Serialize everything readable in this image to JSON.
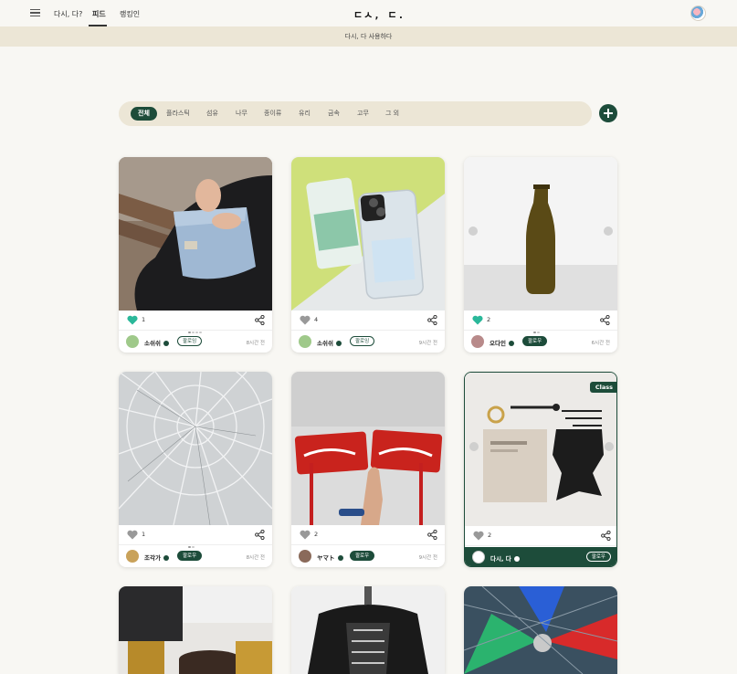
{
  "header": {
    "nav": [
      {
        "label": "다시, 다?"
      },
      {
        "label": "피드"
      },
      {
        "label": "랭킹인"
      }
    ],
    "logo": "ㄷㅅ, ㄷ."
  },
  "banner": {
    "text": "다시, 다 사용하다"
  },
  "filters": {
    "chips": [
      "전체",
      "플라스틱",
      "섬유",
      "나무",
      "종이류",
      "유리",
      "금속",
      "고무",
      "그 외"
    ]
  },
  "cards": [
    {
      "likes": "1",
      "author": "소쉬쉬",
      "follow": "팔로잉",
      "time": "8시간 전",
      "heart": "liked"
    },
    {
      "likes": "4",
      "author": "소쉬쉬",
      "follow": "팔로잉",
      "time": "9시간 전",
      "heart": "plain"
    },
    {
      "likes": "2",
      "author": "오다인",
      "follow": "팔로우",
      "time": "6시간 전",
      "heart": "liked"
    },
    {
      "likes": "1",
      "author": "조각가",
      "follow": "팔로우",
      "time": "8시간 전",
      "heart": "plain"
    },
    {
      "likes": "2",
      "author": "ヤマト",
      "follow": "팔로우",
      "time": "9시간 전",
      "heart": "plain"
    },
    {
      "likes": "2",
      "author": "다시, 다",
      "follow": "팔로우",
      "time": "",
      "heart": "plain",
      "badge": "Class"
    }
  ],
  "colors": {
    "accent": "#1d4c3a",
    "liked": "#2bb89a",
    "banner": "#ece6d6"
  },
  "icons": [
    "menu-icon",
    "heart-icon",
    "share-icon",
    "plus-icon",
    "verified-icon",
    "chevron-left-icon",
    "chevron-right-icon"
  ]
}
